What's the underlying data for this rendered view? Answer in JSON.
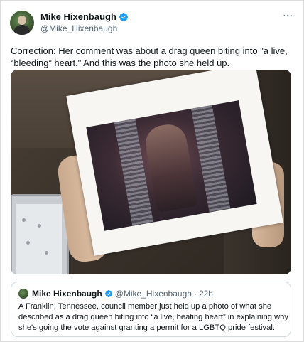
{
  "tweet": {
    "author_name": "Mike Hixenbaugh",
    "author_handle": "@Mike_Hixenbaugh",
    "more_icon": "more-horizontal-icon",
    "verified_icon": "verified-badge-icon",
    "text": "Correction: Her comment was about a drag queen biting into \"a live, “bleeding” heart.\" And this was the photo she held up."
  },
  "quote": {
    "author_name": "Mike Hixenbaugh",
    "author_handle": "@Mike_Hixenbaugh",
    "separator": "·",
    "time": "22h",
    "text": "A Franklin, Tennessee, council member just held up a photo of what she described as a drag queen biting into “a live, beating heart” in explaining why she's going the vote against granting a permit for a LGBTQ pride festival."
  },
  "colors": {
    "accent": "#1d9bf0",
    "text_primary": "#0f1419",
    "text_secondary": "#536471",
    "border": "#cfd9de"
  }
}
